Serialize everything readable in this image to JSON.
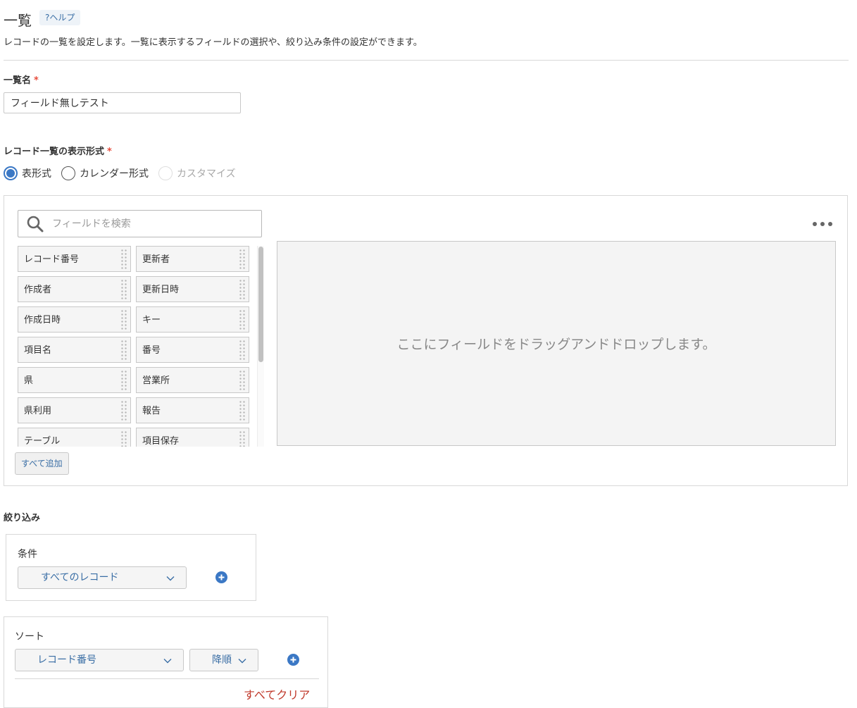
{
  "header": {
    "title": "一覧",
    "help": "?ヘルプ",
    "description": "レコードの一覧を設定します。一覧に表示するフィールドの選択や、絞り込み条件の設定ができます。"
  },
  "list_name": {
    "label": "一覧名",
    "required_mark": "*",
    "value": "フィールド無しテスト"
  },
  "display_format": {
    "label": "レコード一覧の表示形式",
    "required_mark": "*",
    "options": [
      {
        "label": "表形式",
        "selected": true,
        "disabled": false
      },
      {
        "label": "カレンダー形式",
        "selected": false,
        "disabled": false
      },
      {
        "label": "カスタマイズ",
        "selected": false,
        "disabled": true
      }
    ]
  },
  "field_panel": {
    "search_placeholder": "フィールドを検索",
    "fields": [
      "レコード番号",
      "更新者",
      "作成者",
      "更新日時",
      "作成日時",
      "キー",
      "項目名",
      "番号",
      "県",
      "営業所",
      "県利用",
      "報告",
      "テーブル",
      "項目保存"
    ],
    "drop_text": "ここにフィールドをドラッグアンドドロップします。",
    "add_all": "すべて追加"
  },
  "filter": {
    "title": "絞り込み",
    "condition_label": "条件",
    "condition_value": "すべてのレコード"
  },
  "sort": {
    "label": "ソート",
    "field_value": "レコード番号",
    "order_value": "降順",
    "clear_all": "すべてクリア"
  },
  "colors": {
    "accent": "#3b78c5",
    "link": "#3a6ea5",
    "required": "#e74c3c",
    "danger": "#c0392b"
  },
  "icons": [
    "search-icon",
    "more-icon",
    "drag-handle-icon",
    "chevron-down-icon",
    "add-circle-icon"
  ]
}
